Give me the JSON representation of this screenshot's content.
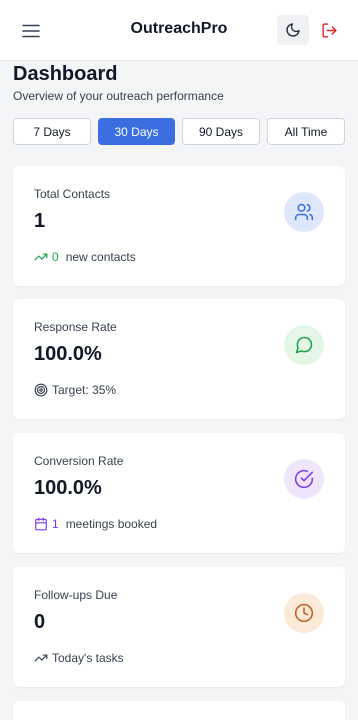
{
  "header": {
    "brand": "OutreachPro",
    "menu_icon": "hamburger-menu-icon",
    "theme_icon": "moon-icon",
    "logout_icon": "logout-icon"
  },
  "page": {
    "title": "Dashboard",
    "subtitle": "Overview of your outreach performance"
  },
  "range_tabs": {
    "items": [
      "7 Days",
      "30 Days",
      "90 Days",
      "All Time"
    ],
    "selected": "30 Days"
  },
  "cards": [
    {
      "label": "Total Contacts",
      "value": "1",
      "foot_icon": "trending-up-icon",
      "foot_number": "0",
      "foot_text": "new contacts",
      "icon": "users-icon",
      "icon_bg": "#dfe8fb",
      "icon_color": "#3b6fe0",
      "foot_color": "#16a34a"
    },
    {
      "label": "Response Rate",
      "value": "100.0%",
      "foot_icon": "target-icon",
      "foot_text": "Target: 35%",
      "icon": "message-circle-icon",
      "icon_bg": "#e4f7e6",
      "icon_color": "#16a34a",
      "foot_color": "#374151"
    },
    {
      "label": "Conversion Rate",
      "value": "100.0%",
      "foot_icon": "calendar-icon",
      "foot_number": "1",
      "foot_text": "meetings booked",
      "icon": "check-circle-icon",
      "icon_bg": "#efe6fb",
      "icon_color": "#7c3aed",
      "foot_color": "#7c3aed"
    },
    {
      "label": "Follow-ups Due",
      "value": "0",
      "foot_icon": "trending-up-icon",
      "foot_text": "Today's tasks",
      "icon": "clock-icon",
      "icon_bg": "#fbead7",
      "icon_color": "#c2581c",
      "foot_color": "#374151"
    }
  ],
  "colors": {
    "accent": "#3b6fe0",
    "logout": "#dc2626"
  }
}
